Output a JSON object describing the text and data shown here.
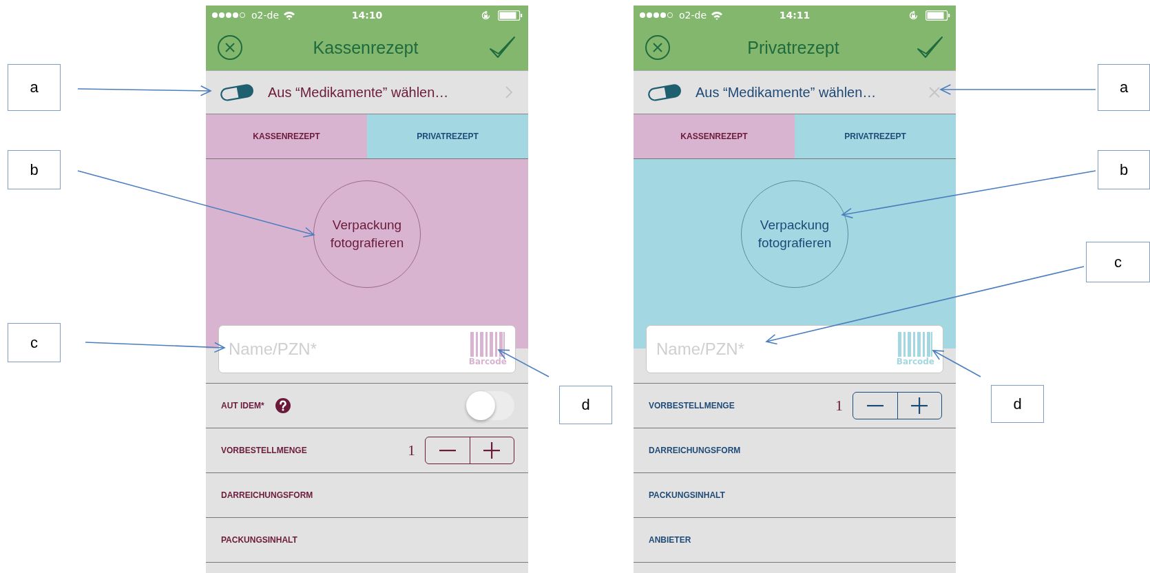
{
  "annotations": [
    {
      "label": "a"
    },
    {
      "label": "b"
    },
    {
      "label": "c"
    },
    {
      "label": "d"
    },
    {
      "label": "a"
    },
    {
      "label": "b"
    },
    {
      "label": "c"
    },
    {
      "label": "d"
    }
  ],
  "screens": [
    {
      "kind": "kassen",
      "status_bar": {
        "carrier": "o2-de",
        "time": "14:10"
      },
      "header": {
        "title": "Kassenrezept"
      },
      "picker": {
        "text": "Aus “Medikamente” wählen…",
        "trailing": {
          "kind": "chevron"
        }
      },
      "tabs": [
        {
          "label": "KASSENREZEPT"
        },
        {
          "label": "PRIVATREZEPT"
        }
      ],
      "photo_button": {
        "text": "Verpackung fotografieren"
      },
      "search_field": {
        "placeholder": "Name/PZN*",
        "barcode_label": "Barcode"
      },
      "rows": [
        {
          "kind": "toggle",
          "label": "AUT IDEM*",
          "help": true,
          "on": false
        },
        {
          "kind": "stepper",
          "label": "VORBESTELLMENGE",
          "value": "1"
        },
        {
          "kind": "plain",
          "label": "DARREICHUNGSFORM"
        },
        {
          "kind": "plain",
          "label": "PACKUNGSINHALT"
        }
      ]
    },
    {
      "kind": "privat",
      "status_bar": {
        "carrier": "o2-de",
        "time": "14:11"
      },
      "header": {
        "title": "Privatrezept"
      },
      "picker": {
        "text": "Aus “Medikamente” wählen…",
        "trailing": {
          "kind": "clear"
        }
      },
      "tabs": [
        {
          "label": "KASSENREZEPT"
        },
        {
          "label": "PRIVATREZEPT"
        }
      ],
      "photo_button": {
        "text": "Verpackung fotografieren"
      },
      "search_field": {
        "placeholder": "Name/PZN*",
        "barcode_label": "Barcode"
      },
      "rows": [
        {
          "kind": "stepper",
          "label": "VORBESTELLMENGE",
          "value": "1"
        },
        {
          "kind": "plain",
          "label": "DARREICHUNGSFORM"
        },
        {
          "kind": "plain",
          "label": "PACKUNGSINHALT"
        },
        {
          "kind": "plain",
          "label": "ANBIETER"
        }
      ]
    }
  ]
}
